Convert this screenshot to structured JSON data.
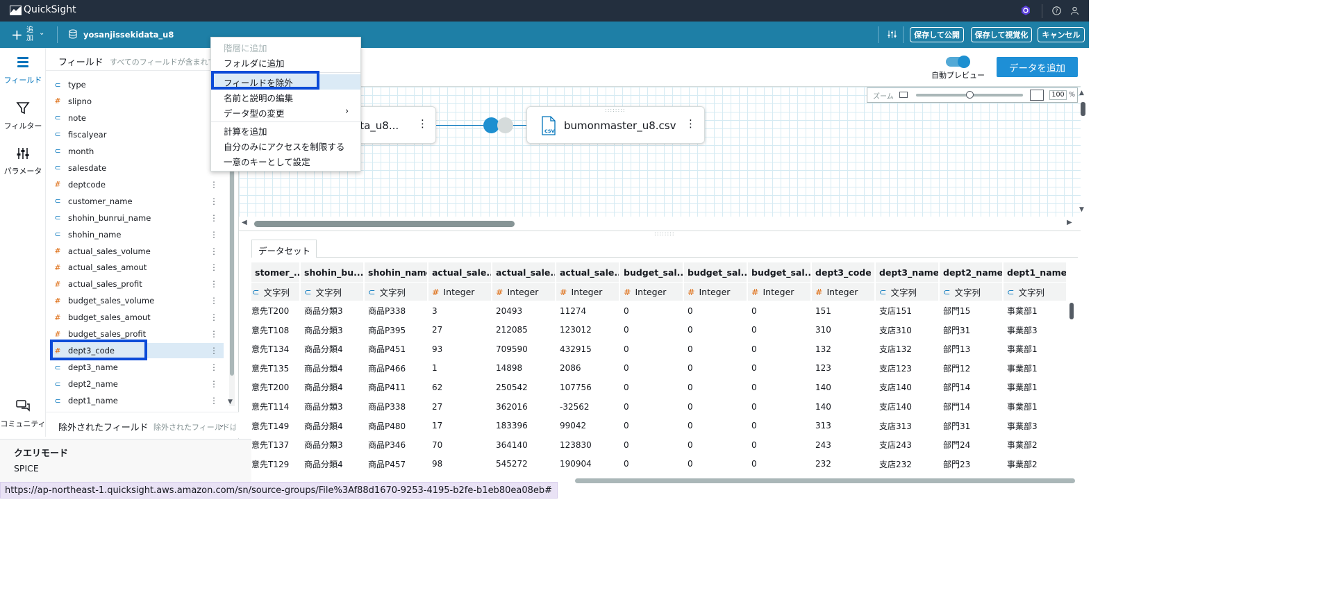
{
  "app": {
    "brand": "QuickSight"
  },
  "toolbar": {
    "add_label": "追加",
    "dataset_name": "yosanjissekidata_u8",
    "save_publish": "保存して公開",
    "save_visualize": "保存して視覚化",
    "cancel": "キャンセル"
  },
  "rail": {
    "fields": "フィールド",
    "filter": "フィルター",
    "params": "パラメータ",
    "community": "コミュニティ"
  },
  "field_panel": {
    "title": "フィールド",
    "subtitle": "すべてのフィールドが含まれて",
    "excluded_title": "除外されたフィールド",
    "excluded_sub": "除外されたフィールドは",
    "fields": [
      {
        "name": "type",
        "type": "str"
      },
      {
        "name": "slipno",
        "type": "num"
      },
      {
        "name": "note",
        "type": "str"
      },
      {
        "name": "fiscalyear",
        "type": "str"
      },
      {
        "name": "month",
        "type": "str"
      },
      {
        "name": "salesdate",
        "type": "str"
      },
      {
        "name": "deptcode",
        "type": "num"
      },
      {
        "name": "customer_name",
        "type": "str"
      },
      {
        "name": "shohin_bunrui_name",
        "type": "str"
      },
      {
        "name": "shohin_name",
        "type": "str"
      },
      {
        "name": "actual_sales_volume",
        "type": "num"
      },
      {
        "name": "actual_sales_amout",
        "type": "num"
      },
      {
        "name": "actual_sales_profit",
        "type": "num"
      },
      {
        "name": "budget_sales_volume",
        "type": "num"
      },
      {
        "name": "budget_sales_amout",
        "type": "num"
      },
      {
        "name": "budget_sales_profit",
        "type": "num"
      },
      {
        "name": "dept3_code",
        "type": "num"
      },
      {
        "name": "dept3_name",
        "type": "str"
      },
      {
        "name": "dept2_name",
        "type": "str"
      },
      {
        "name": "dept1_name",
        "type": "str"
      }
    ],
    "selected_field": "dept3_code"
  },
  "query_mode": {
    "title": "クエリモード",
    "value": "SPICE"
  },
  "context_menu": {
    "items": [
      {
        "label": "階層に追加",
        "disabled": true
      },
      {
        "label": "フォルダに追加",
        "disabled": false
      },
      {
        "label": "フィールドを除外",
        "disabled": false,
        "highlighted": true
      },
      {
        "label": "名前と説明の編集",
        "disabled": false
      },
      {
        "label": "データ型の変更",
        "disabled": false,
        "submenu": true
      },
      {
        "label": "計算を追加",
        "disabled": false
      },
      {
        "label": "自分のみにアクセスを制限する",
        "disabled": false
      },
      {
        "label": "一意のキーとして設定",
        "disabled": false
      }
    ]
  },
  "canvas": {
    "auto_preview": "自動プレビュー",
    "add_data": "データを追加",
    "zoom_label": "ズーム",
    "zoom_value": "100",
    "zoom_unit": "%",
    "left_node": "ata_u8...",
    "right_node": "bumonmaster_u8.csv",
    "csv_badge": "CSV"
  },
  "dataset_tab": "データセット",
  "table": {
    "columns": [
      {
        "name": "stomer_...",
        "type_icon": "str",
        "type": "文字列"
      },
      {
        "name": "shohin_bu...",
        "type_icon": "str",
        "type": "文字列"
      },
      {
        "name": "shohin_name",
        "type_icon": "str",
        "type": "文字列"
      },
      {
        "name": "actual_sale...",
        "type_icon": "num",
        "type": "Integer"
      },
      {
        "name": "actual_sale...",
        "type_icon": "num",
        "type": "Integer"
      },
      {
        "name": "actual_sale...",
        "type_icon": "num",
        "type": "Integer"
      },
      {
        "name": "budget_sal...",
        "type_icon": "num",
        "type": "Integer"
      },
      {
        "name": "budget_sal...",
        "type_icon": "num",
        "type": "Integer"
      },
      {
        "name": "budget_sal...",
        "type_icon": "num",
        "type": "Integer"
      },
      {
        "name": "dept3_code",
        "type_icon": "num",
        "type": "Integer"
      },
      {
        "name": "dept3_name",
        "type_icon": "str",
        "type": "文字列"
      },
      {
        "name": "dept2_name",
        "type_icon": "str",
        "type": "文字列"
      },
      {
        "name": "dept1_name",
        "type_icon": "str",
        "type": "文字列"
      }
    ],
    "rows": [
      [
        "意先T200",
        "商品分類3",
        "商品P338",
        "3",
        "20493",
        "11274",
        "0",
        "0",
        "0",
        "151",
        "支店151",
        "部門15",
        "事業部1"
      ],
      [
        "意先T108",
        "商品分類3",
        "商品P395",
        "27",
        "212085",
        "123012",
        "0",
        "0",
        "0",
        "310",
        "支店310",
        "部門31",
        "事業部3"
      ],
      [
        "意先T134",
        "商品分類4",
        "商品P451",
        "93",
        "709590",
        "432915",
        "0",
        "0",
        "0",
        "132",
        "支店132",
        "部門13",
        "事業部1"
      ],
      [
        "意先T135",
        "商品分類4",
        "商品P466",
        "1",
        "14898",
        "2086",
        "0",
        "0",
        "0",
        "123",
        "支店123",
        "部門12",
        "事業部1"
      ],
      [
        "意先T200",
        "商品分類4",
        "商品P411",
        "62",
        "250542",
        "107756",
        "0",
        "0",
        "0",
        "140",
        "支店140",
        "部門14",
        "事業部1"
      ],
      [
        "意先T114",
        "商品分類3",
        "商品P338",
        "27",
        "362016",
        "-32562",
        "0",
        "0",
        "0",
        "140",
        "支店140",
        "部門14",
        "事業部1"
      ],
      [
        "意先T149",
        "商品分類4",
        "商品P480",
        "17",
        "183396",
        "99042",
        "0",
        "0",
        "0",
        "313",
        "支店313",
        "部門31",
        "事業部3"
      ],
      [
        "意先T137",
        "商品分類3",
        "商品P346",
        "70",
        "364140",
        "123830",
        "0",
        "0",
        "0",
        "243",
        "支店243",
        "部門24",
        "事業部2"
      ],
      [
        "意先T129",
        "商品分類4",
        "商品P457",
        "98",
        "545272",
        "190904",
        "0",
        "0",
        "0",
        "232",
        "支店232",
        "部門23",
        "事業部2"
      ]
    ]
  },
  "status_url": "https://ap-northeast-1.quicksight.aws.amazon.com/sn/source-groups/File%3Af88d1670-9253-4195-b2fe-b1eb80ea08eb#",
  "colors": {
    "topbar": "#232f3e",
    "toolbar": "#1e7fa6",
    "accent": "#0073bb",
    "highlight_box": "#0b4bd8"
  }
}
